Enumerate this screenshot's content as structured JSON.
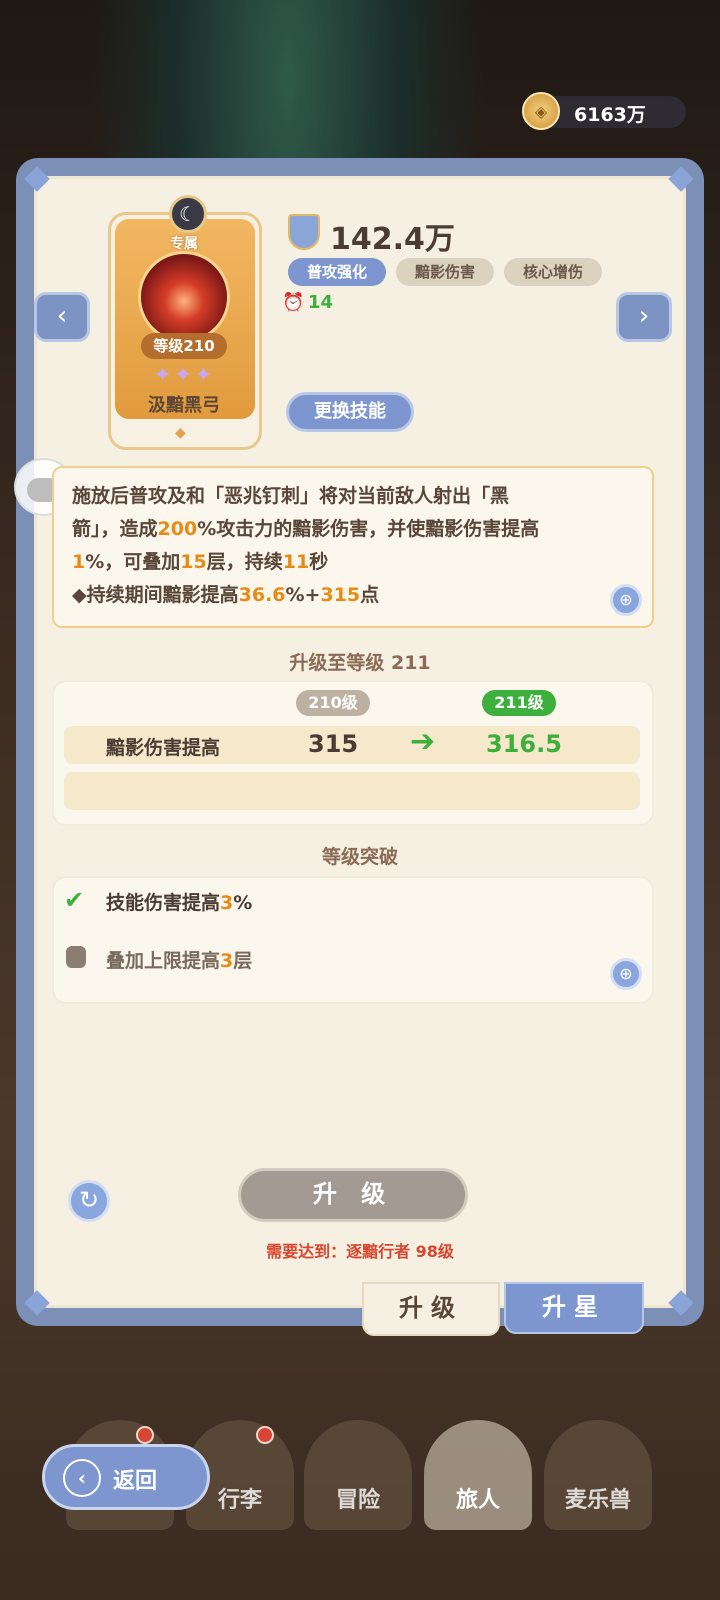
{
  "currency": {
    "icon": "coin-icon",
    "value": "6163万"
  },
  "skill_card": {
    "badge": "专属",
    "level": "等级210",
    "stars": "✦✦✦",
    "name": "汲黯黑弓"
  },
  "skill": {
    "power": "142.4万",
    "tags": [
      "普攻强化",
      "黯影伤害",
      "核心增伤"
    ],
    "cooldown": "14",
    "change_button": "更换技能"
  },
  "description": {
    "line1": "施放后普攻及和「恶兆钉刺」将对当前敌人射出「黑",
    "line2a": "箭」，造成",
    "line2b": "200",
    "line2c": "%攻击力的黯影伤害，并使黯影伤害提高",
    "line3a": "1",
    "line3b": "%，可叠加",
    "line3c": "15",
    "line3d": "层，持续",
    "line3e": "11",
    "line3f": "秒",
    "line4a": "◆持续期间黯影提高",
    "line4b": "36.6",
    "line4c": "%+",
    "line4d": "315",
    "line4e": "点"
  },
  "upgrade": {
    "header": "升级至等级 211",
    "from_level": "210级",
    "to_level": "211级",
    "stat_label": "黯影伤害提高",
    "from_value": "315",
    "to_value": "316.5"
  },
  "breakthrough": {
    "header": "等级突破",
    "item1a": "技能伤害提高",
    "item1b": "3",
    "item1c": "%",
    "item2a": "叠加上限提高",
    "item2b": "3",
    "item2c": "层"
  },
  "actions": {
    "upgrade_button": "升 级",
    "requirement": "需要达到：逐黯行者 98级"
  },
  "tabs": {
    "upgrade": "升级",
    "star": "升星"
  },
  "nav": {
    "back": "返回",
    "items": [
      "行李",
      "冒险",
      "旅人",
      "麦乐兽"
    ]
  },
  "colors": {
    "accent": "#7d96cf",
    "highlight": "#e88a16",
    "green": "#3caf3c",
    "warning": "#d9462f"
  }
}
